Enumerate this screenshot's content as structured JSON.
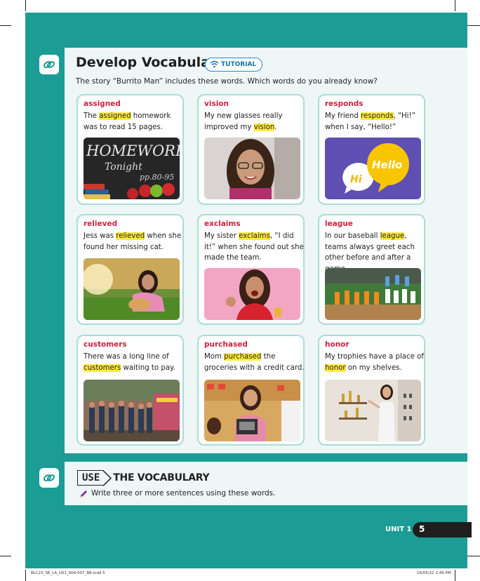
{
  "header": {
    "title": "Develop Vocabulary",
    "tutorial_label": "TUTORIAL",
    "subtitle": "The story “Burrito Man” includes these words. Which words do you already know?"
  },
  "cards": [
    {
      "word": "assigned",
      "pre": "The ",
      "hl": "assigned",
      "post": " homework was to read 15 pages.",
      "image": "homework-chalkboard-photo",
      "board_line1": "HOMEWORK",
      "board_line2": "Tonight",
      "board_line3": "pp.80-95"
    },
    {
      "word": "vision",
      "pre": "My new glasses really improved my ",
      "hl": "vision",
      "post": ".",
      "image": "girl-with-glasses-photo"
    },
    {
      "word": "responds",
      "pre": "My friend ",
      "hl": "responds",
      "post": ", “Hi!” when I say, “Hello!”",
      "image": "speech-bubbles-illustration",
      "bubble_small": "Hi",
      "bubble_big": "Hello"
    },
    {
      "word": "relieved",
      "pre": "Jess was ",
      "hl": "relieved",
      "post": " when she found her missing cat.",
      "image": "girl-with-cat-photo"
    },
    {
      "word": "exclaims",
      "pre": "My sister ",
      "hl": "exclaims",
      "post": ", “I did it!” when she found out she made the team.",
      "image": "excited-girl-photo"
    },
    {
      "word": "league",
      "pre": "In our baseball ",
      "hl": "league",
      "post": ", teams always greet each other before and after a game.",
      "image": "baseball-teams-photo"
    },
    {
      "word": "customers",
      "pre": "There was a long line of ",
      "hl": "customers",
      "post": " waiting to pay.",
      "image": "line-of-customers-photo"
    },
    {
      "word": "purchased",
      "pre": "Mom ",
      "hl": "purchased",
      "post": " the groceries with a credit card.",
      "image": "grocery-checkout-photo"
    },
    {
      "word": "honor",
      "pre": "My trophies have a place of ",
      "hl": "honor",
      "post": " on my shelves.",
      "image": "trophy-shelf-photo"
    }
  ],
  "use": {
    "tag": "USE",
    "rest": "THE VOCABULARY",
    "instruction": "Write three or more sentences using these words."
  },
  "footer": {
    "unit": "UNIT 1",
    "page": "5",
    "slug_left": "BLC23_SE_LA_U01_004-007_BR.indd   5",
    "slug_right": "16/05/22   2:49 PM"
  },
  "colors": {
    "teal": "#1b9c95",
    "panel": "#eef7f5",
    "word_red": "#d0213f",
    "highlight": "#ffea3d",
    "card_border": "#a9ddd9"
  }
}
